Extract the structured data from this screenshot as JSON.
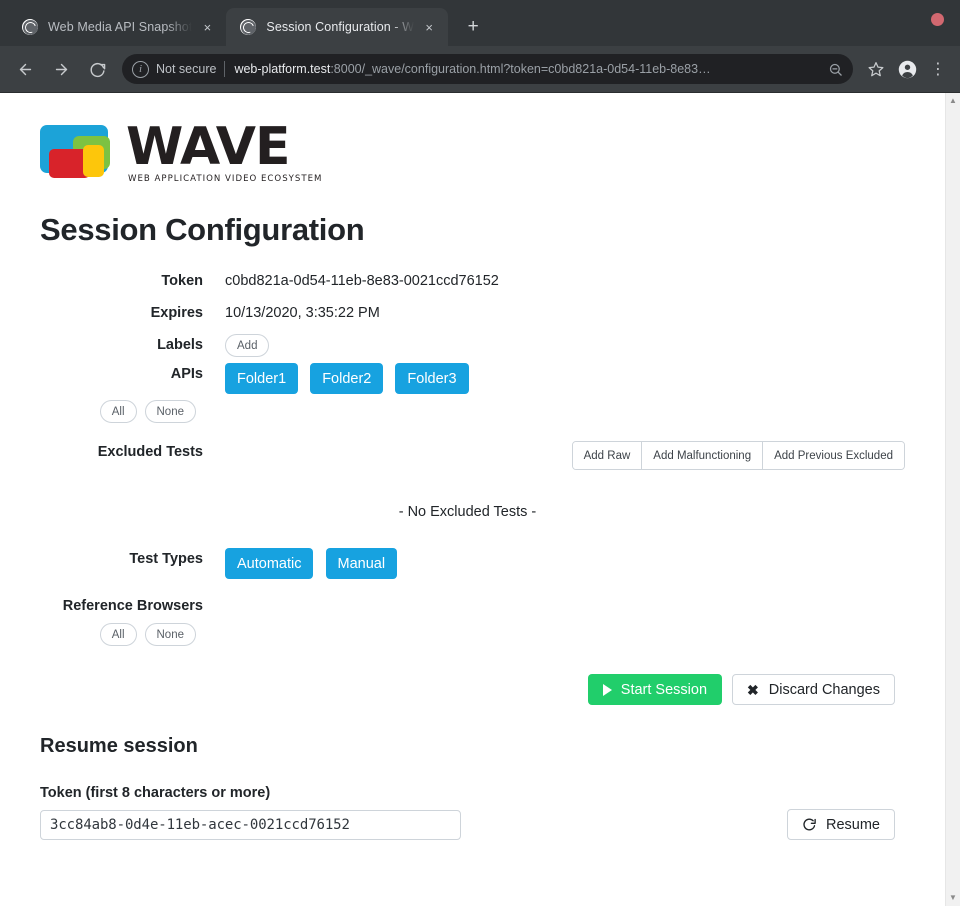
{
  "browser": {
    "tabs": [
      {
        "title": "Web Media API Snapshot",
        "active": false,
        "favicon": "globe-icon",
        "close": "×"
      },
      {
        "title": "Session Configuration - W",
        "active": true,
        "favicon": "globe-icon",
        "close": "×"
      }
    ],
    "new_tab_label": "+",
    "window_close_dot": "",
    "nav": {
      "back": "back-arrow-icon",
      "forward": "forward-arrow-icon",
      "reload": "reload-icon"
    },
    "omnibox": {
      "security_label": "Not secure",
      "info_glyph": "i",
      "url_host": "web-platform.test",
      "url_rest": ":8000/_wave/configuration.html?token=c0bd821a-0d54-11eb-8e83…",
      "zoom_icon": "zoom-out-icon"
    },
    "toolbar_icons": {
      "bookmark": "☆",
      "profile": "profile-avatar-icon",
      "menu": "⋮"
    },
    "scrollbar": {
      "up": "▲",
      "down": "▼"
    }
  },
  "logo": {
    "word": "WAVE",
    "tagline": "WEB APPLICATION VIDEO ECOSYSTEM",
    "colors": {
      "blue": "#1ca3d8",
      "green": "#7dc242",
      "red": "#d8232a",
      "yellow": "#fdc60b"
    }
  },
  "page": {
    "title": "Session Configuration",
    "fields": {
      "token_label": "Token",
      "token_value": "c0bd821a-0d54-11eb-8e83-0021ccd76152",
      "expires_label": "Expires",
      "expires_value": "10/13/2020, 3:35:22 PM",
      "labels_label": "Labels",
      "labels_add": "Add",
      "apis_label": "APIs",
      "apis": [
        "Folder1",
        "Folder2",
        "Folder3"
      ],
      "apis_all": "All",
      "apis_none": "None",
      "excluded_label": "Excluded Tests",
      "excluded_actions": [
        "Add Raw",
        "Add Malfunctioning",
        "Add Previous Excluded"
      ],
      "excluded_empty": "- No Excluded Tests -",
      "test_types_label": "Test Types",
      "test_types": [
        "Automatic",
        "Manual"
      ],
      "ref_browsers_label": "Reference Browsers",
      "ref_browsers_all": "All",
      "ref_browsers_none": "None"
    },
    "actions": {
      "start_label": "Start Session",
      "start_icon": "play-icon",
      "discard_label": "Discard Changes",
      "discard_icon": "close-x-icon"
    },
    "resume": {
      "heading": "Resume session",
      "field_label": "Token (first 8 characters or more)",
      "token_value": "3cc84ab8-0d4e-11eb-acec-0021ccd76152",
      "token_placeholder": "",
      "button_label": "Resume",
      "button_icon": "refresh-icon"
    }
  },
  "colors": {
    "chip_blue": "#17a2e0",
    "start_green": "#21ce6b",
    "chrome_dark": "#323639",
    "omnibox_dark": "#202124"
  }
}
